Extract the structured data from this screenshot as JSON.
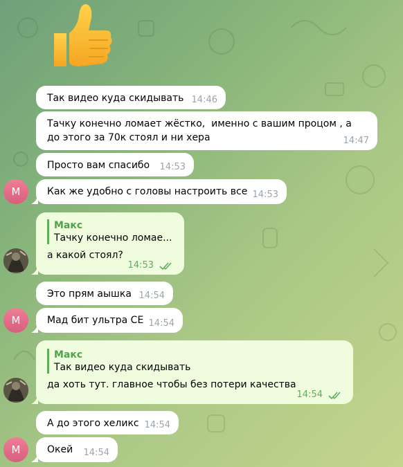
{
  "sticker": {
    "icon": "thumbs-up-icon"
  },
  "avatar_m_letter": "М",
  "messages": [
    {
      "text": "Так видео куда скидывать",
      "time": "14:46"
    },
    {
      "text": "Тачку конечно ломает жёстко,  именно с вашим процом , а до этого за 70к стоял и ни хера",
      "time": "14:47"
    },
    {
      "text": "Просто вам спасибо",
      "time": "14:53"
    },
    {
      "text": "Как же удобно с головы настроить все",
      "time": "14:53"
    },
    {
      "quote_name": "Макс",
      "quote_text": "Тачку конечно ломае...",
      "text": "а какой стоял?",
      "time": "14:53"
    },
    {
      "text": "Это прям аышка",
      "time": "14:54"
    },
    {
      "text": "Мад бит ультра СЕ",
      "time": "14:54"
    },
    {
      "quote_name": "Макс",
      "quote_text": "Так видео куда скидывать",
      "text": "да хоть тут. главное чтобы без потери качества",
      "time": "14:54"
    },
    {
      "text": "А до этого хеликс",
      "time": "14:54"
    },
    {
      "text": "Окей",
      "time": "14:54"
    }
  ],
  "colors": {
    "outgoing_bubble": "#effdde",
    "incoming_bubble": "#ffffff",
    "accent_green": "#4fa24a",
    "avatar_pink": "#e5708c"
  }
}
